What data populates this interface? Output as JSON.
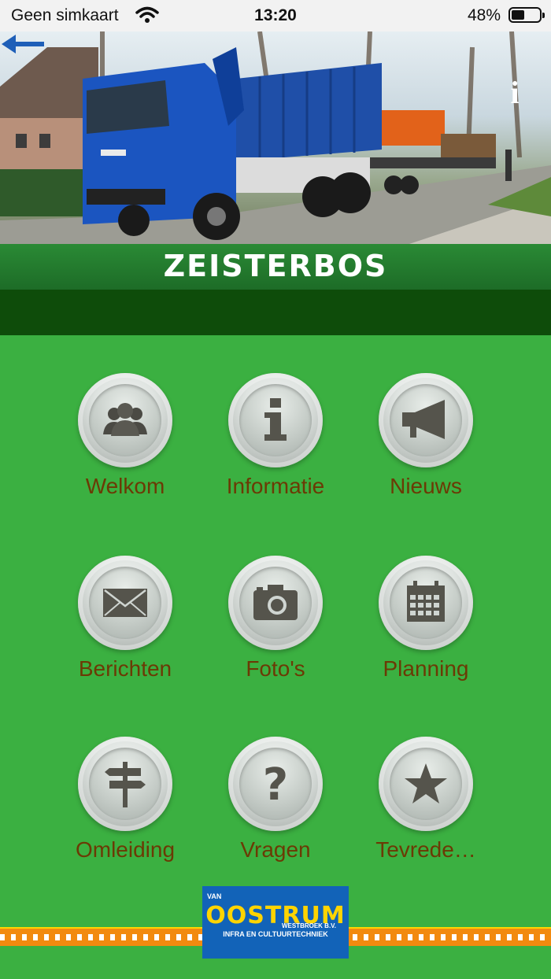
{
  "status_bar": {
    "carrier": "Geen simkaart",
    "time": "13:20",
    "battery": "48%",
    "battery_level": 0.48
  },
  "header": {
    "title": "ZEISTERBOS"
  },
  "menu": [
    {
      "label": "Welkom",
      "icon": "group-icon"
    },
    {
      "label": "Informatie",
      "icon": "info-icon"
    },
    {
      "label": "Nieuws",
      "icon": "megaphone-icon"
    },
    {
      "label": "Berichten",
      "icon": "envelope-icon"
    },
    {
      "label": "Foto's",
      "icon": "camera-icon"
    },
    {
      "label": "Planning",
      "icon": "calendar-icon"
    },
    {
      "label": "Omleiding",
      "icon": "signpost-icon"
    },
    {
      "label": "Vragen",
      "icon": "question-icon"
    },
    {
      "label": "Tevrede…",
      "icon": "star-icon"
    }
  ],
  "logo": {
    "prefix": "VAN",
    "name": "OOSTRUM",
    "suffix": "WESTBROEK B.V.",
    "tagline": "INFRA EN CULTUURTECHNIEK"
  },
  "colors": {
    "background": "#3bb041",
    "label_text": "#6b3a05",
    "title_band": "#1d6c27",
    "dark_band": "#0e4c0a",
    "logo_blue": "#1263b8",
    "logo_yellow": "#ffd400",
    "stripe_orange": "#f28a0f"
  }
}
